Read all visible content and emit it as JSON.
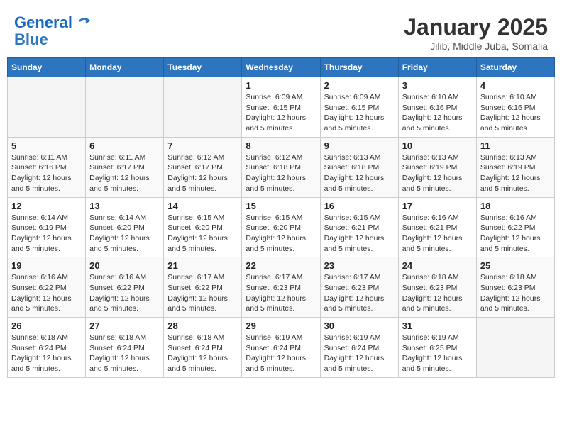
{
  "header": {
    "logo_line1": "General",
    "logo_line2": "Blue",
    "month": "January 2025",
    "location": "Jilib, Middle Juba, Somalia"
  },
  "weekdays": [
    "Sunday",
    "Monday",
    "Tuesday",
    "Wednesday",
    "Thursday",
    "Friday",
    "Saturday"
  ],
  "weeks": [
    [
      {
        "day": "",
        "info": ""
      },
      {
        "day": "",
        "info": ""
      },
      {
        "day": "",
        "info": ""
      },
      {
        "day": "1",
        "info": "Sunrise: 6:09 AM\nSunset: 6:15 PM\nDaylight: 12 hours and 5 minutes."
      },
      {
        "day": "2",
        "info": "Sunrise: 6:09 AM\nSunset: 6:15 PM\nDaylight: 12 hours and 5 minutes."
      },
      {
        "day": "3",
        "info": "Sunrise: 6:10 AM\nSunset: 6:16 PM\nDaylight: 12 hours and 5 minutes."
      },
      {
        "day": "4",
        "info": "Sunrise: 6:10 AM\nSunset: 6:16 PM\nDaylight: 12 hours and 5 minutes."
      }
    ],
    [
      {
        "day": "5",
        "info": "Sunrise: 6:11 AM\nSunset: 6:16 PM\nDaylight: 12 hours and 5 minutes."
      },
      {
        "day": "6",
        "info": "Sunrise: 6:11 AM\nSunset: 6:17 PM\nDaylight: 12 hours and 5 minutes."
      },
      {
        "day": "7",
        "info": "Sunrise: 6:12 AM\nSunset: 6:17 PM\nDaylight: 12 hours and 5 minutes."
      },
      {
        "day": "8",
        "info": "Sunrise: 6:12 AM\nSunset: 6:18 PM\nDaylight: 12 hours and 5 minutes."
      },
      {
        "day": "9",
        "info": "Sunrise: 6:13 AM\nSunset: 6:18 PM\nDaylight: 12 hours and 5 minutes."
      },
      {
        "day": "10",
        "info": "Sunrise: 6:13 AM\nSunset: 6:19 PM\nDaylight: 12 hours and 5 minutes."
      },
      {
        "day": "11",
        "info": "Sunrise: 6:13 AM\nSunset: 6:19 PM\nDaylight: 12 hours and 5 minutes."
      }
    ],
    [
      {
        "day": "12",
        "info": "Sunrise: 6:14 AM\nSunset: 6:19 PM\nDaylight: 12 hours and 5 minutes."
      },
      {
        "day": "13",
        "info": "Sunrise: 6:14 AM\nSunset: 6:20 PM\nDaylight: 12 hours and 5 minutes."
      },
      {
        "day": "14",
        "info": "Sunrise: 6:15 AM\nSunset: 6:20 PM\nDaylight: 12 hours and 5 minutes."
      },
      {
        "day": "15",
        "info": "Sunrise: 6:15 AM\nSunset: 6:20 PM\nDaylight: 12 hours and 5 minutes."
      },
      {
        "day": "16",
        "info": "Sunrise: 6:15 AM\nSunset: 6:21 PM\nDaylight: 12 hours and 5 minutes."
      },
      {
        "day": "17",
        "info": "Sunrise: 6:16 AM\nSunset: 6:21 PM\nDaylight: 12 hours and 5 minutes."
      },
      {
        "day": "18",
        "info": "Sunrise: 6:16 AM\nSunset: 6:22 PM\nDaylight: 12 hours and 5 minutes."
      }
    ],
    [
      {
        "day": "19",
        "info": "Sunrise: 6:16 AM\nSunset: 6:22 PM\nDaylight: 12 hours and 5 minutes."
      },
      {
        "day": "20",
        "info": "Sunrise: 6:16 AM\nSunset: 6:22 PM\nDaylight: 12 hours and 5 minutes."
      },
      {
        "day": "21",
        "info": "Sunrise: 6:17 AM\nSunset: 6:22 PM\nDaylight: 12 hours and 5 minutes."
      },
      {
        "day": "22",
        "info": "Sunrise: 6:17 AM\nSunset: 6:23 PM\nDaylight: 12 hours and 5 minutes."
      },
      {
        "day": "23",
        "info": "Sunrise: 6:17 AM\nSunset: 6:23 PM\nDaylight: 12 hours and 5 minutes."
      },
      {
        "day": "24",
        "info": "Sunrise: 6:18 AM\nSunset: 6:23 PM\nDaylight: 12 hours and 5 minutes."
      },
      {
        "day": "25",
        "info": "Sunrise: 6:18 AM\nSunset: 6:23 PM\nDaylight: 12 hours and 5 minutes."
      }
    ],
    [
      {
        "day": "26",
        "info": "Sunrise: 6:18 AM\nSunset: 6:24 PM\nDaylight: 12 hours and 5 minutes."
      },
      {
        "day": "27",
        "info": "Sunrise: 6:18 AM\nSunset: 6:24 PM\nDaylight: 12 hours and 5 minutes."
      },
      {
        "day": "28",
        "info": "Sunrise: 6:18 AM\nSunset: 6:24 PM\nDaylight: 12 hours and 5 minutes."
      },
      {
        "day": "29",
        "info": "Sunrise: 6:19 AM\nSunset: 6:24 PM\nDaylight: 12 hours and 5 minutes."
      },
      {
        "day": "30",
        "info": "Sunrise: 6:19 AM\nSunset: 6:24 PM\nDaylight: 12 hours and 5 minutes."
      },
      {
        "day": "31",
        "info": "Sunrise: 6:19 AM\nSunset: 6:25 PM\nDaylight: 12 hours and 5 minutes."
      },
      {
        "day": "",
        "info": ""
      }
    ]
  ]
}
